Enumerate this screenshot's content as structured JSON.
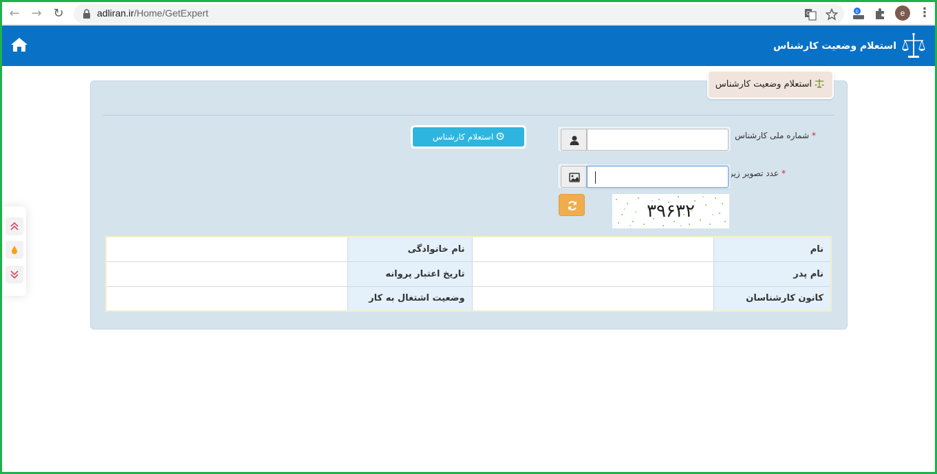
{
  "browser": {
    "url_host": "adliran.ir",
    "url_path": "/Home/GetExpert",
    "avatar_letter": "e"
  },
  "header": {
    "title": "استعلام وضعیت کارشناس"
  },
  "panel": {
    "tab_title": "استعلام وضعیت کارشناس"
  },
  "form": {
    "national_id_label": "شماره ملی کارشناس",
    "national_id_value": "",
    "captcha_label": "عدد تصویر زیر",
    "captcha_value": "",
    "required_mark": "*",
    "captcha_digits": "۳۹۶۳۲",
    "submit_label": "استعلام کارشناس"
  },
  "results": {
    "rows": [
      {
        "label_a": "نام",
        "value_a": "",
        "label_b": "نام خانوادگی",
        "value_b": ""
      },
      {
        "label_a": "نام پدر",
        "value_a": "",
        "label_b": "تاریخ اعتبار پروانه",
        "value_b": ""
      },
      {
        "label_a": "کانون کارشناسان",
        "value_a": "",
        "label_b": "وضعیت اشتغال به کار",
        "value_b": ""
      }
    ]
  },
  "colors": {
    "header_bg": "#0a72c6",
    "panel_bg": "#d5e3ed",
    "submit_bg": "#2db5e0",
    "refresh_bg": "#f0ad4e",
    "required": "#e2231a"
  }
}
